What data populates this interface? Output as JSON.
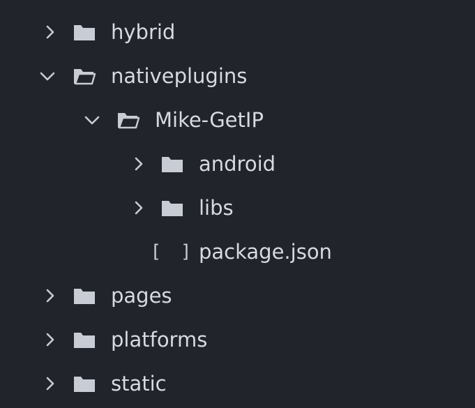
{
  "colors": {
    "background": "#21252b",
    "text": "#d7dae0",
    "icon": "#c8ccd4"
  },
  "tree": {
    "cut_off_top": "",
    "items": [
      {
        "label": "hybrid",
        "type": "folder",
        "expanded": false,
        "depth": 0,
        "icon": "folder-icon"
      },
      {
        "label": "nativeplugins",
        "type": "folder",
        "expanded": true,
        "depth": 0,
        "icon": "folder-open-icon"
      },
      {
        "label": "Mike-GetIP",
        "type": "folder",
        "expanded": true,
        "depth": 1,
        "icon": "folder-open-icon"
      },
      {
        "label": "android",
        "type": "folder",
        "expanded": false,
        "depth": 2,
        "icon": "folder-icon"
      },
      {
        "label": "libs",
        "type": "folder",
        "expanded": false,
        "depth": 2,
        "icon": "folder-icon"
      },
      {
        "label": "package.json",
        "type": "file",
        "depth": 2,
        "icon": "json-file-icon",
        "icon_glyph": "[ ]"
      },
      {
        "label": "pages",
        "type": "folder",
        "expanded": false,
        "depth": 0,
        "icon": "folder-icon"
      },
      {
        "label": "platforms",
        "type": "folder",
        "expanded": false,
        "depth": 0,
        "icon": "folder-icon"
      },
      {
        "label": "static",
        "type": "folder",
        "expanded": false,
        "depth": 0,
        "icon": "folder-icon"
      }
    ]
  }
}
